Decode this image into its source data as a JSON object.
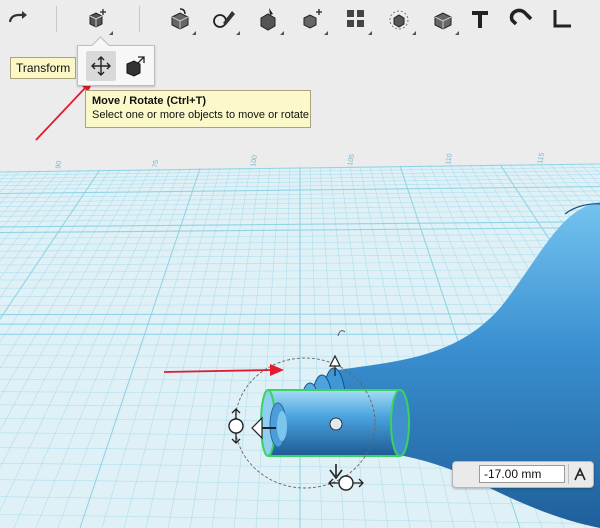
{
  "app": {
    "toolbar": {
      "tools": [
        {
          "name": "redo",
          "icon": "redo-arrow-icon"
        },
        {
          "name": "transform",
          "icon": "transform-cube-icon"
        },
        {
          "name": "primitives",
          "icon": "primitive-cube-icon"
        },
        {
          "name": "sketch",
          "icon": "sketch-pencil-icon"
        },
        {
          "name": "construct",
          "icon": "construct-cube-icon"
        },
        {
          "name": "modify",
          "icon": "modify-cube-icon"
        },
        {
          "name": "pattern",
          "icon": "pattern-grid-icon"
        },
        {
          "name": "grouping",
          "icon": "grouping-cube-icon"
        },
        {
          "name": "combine",
          "icon": "combine-cube-icon"
        },
        {
          "name": "text",
          "icon": "text-t-icon"
        },
        {
          "name": "snap",
          "icon": "magnet-snap-icon"
        },
        {
          "name": "measure",
          "icon": "measure-ruler-icon"
        }
      ]
    },
    "transform_label": "Transform",
    "subtools": [
      {
        "name": "move-rotate",
        "icon": "move-rotate-icon",
        "active": true
      },
      {
        "name": "scale",
        "icon": "scale-cube-icon",
        "active": false
      }
    ],
    "tooltip": {
      "title": "Move / Rotate (Ctrl+T)",
      "description": "Select one or more objects to move or rotate"
    },
    "ruler_ticks": [
      "90",
      "75",
      "100",
      "105",
      "110",
      "115"
    ],
    "readout": {
      "value": "-17.00 mm"
    },
    "colors": {
      "grid_line": "#8ad2e3",
      "grid_bg": "#dff0f7",
      "model_blue": "#3e93d1",
      "selection_green": "#39d35f",
      "annotation_red": "#e21b2e"
    }
  }
}
